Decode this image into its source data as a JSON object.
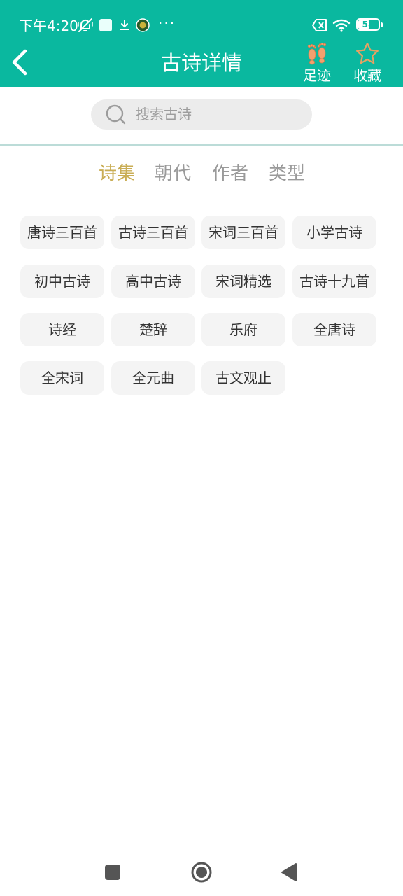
{
  "status_bar": {
    "time": "下午4:20",
    "more": "···",
    "battery": {
      "level": "58",
      "percent": 58
    }
  },
  "app_bar": {
    "title": "古诗详情",
    "actions": [
      {
        "label": "足迹",
        "icon": "footprint-icon"
      },
      {
        "label": "收藏",
        "icon": "star-icon"
      }
    ]
  },
  "search": {
    "placeholder": "搜索古诗",
    "icon": "search-icon"
  },
  "tabs": [
    {
      "label": "诗集",
      "active": true
    },
    {
      "label": "朝代",
      "active": false
    },
    {
      "label": "作者",
      "active": false
    },
    {
      "label": "类型",
      "active": false
    }
  ],
  "collections": [
    "唐诗三百首",
    "古诗三百首",
    "宋词三百首",
    "小学古诗",
    "初中古诗",
    "高中古诗",
    "宋词精选",
    "古诗十九首",
    "诗经",
    "楚辞",
    "乐府",
    "全唐诗",
    "全宋词",
    "全元曲",
    "古文观止"
  ],
  "colors": {
    "primary": "#0ab89f",
    "tab_active": "#c9ad55",
    "tab_inactive": "#9a9a9a",
    "chip_bg": "#f4f4f4",
    "footprint": "#f3a06e",
    "star": "#e8a262"
  },
  "nav_bar": {
    "buttons": [
      "recents-square-icon",
      "home-circle-icon",
      "back-triangle-icon"
    ]
  }
}
